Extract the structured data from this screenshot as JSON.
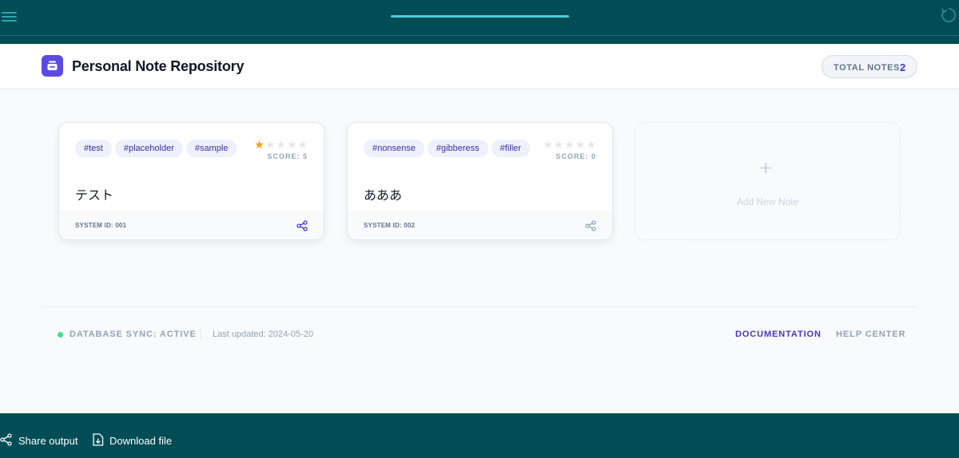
{
  "app": {
    "title": "Personal Note Repository",
    "total_label": "TOTAL NOTES",
    "total_count": "2"
  },
  "notes": [
    {
      "tags": [
        "#test",
        "#placeholder",
        "#sample"
      ],
      "rating": 1,
      "max_rating": 5,
      "score_label": "SCORE: 5",
      "content": "テスト",
      "system_id": "SYSTEM ID: 001"
    },
    {
      "tags": [
        "#nonsense",
        "#gibberess",
        "#filler"
      ],
      "rating": 0,
      "max_rating": 5,
      "score_label": "SCORE: 0",
      "content": "あああ",
      "system_id": "SYSTEM ID: 002"
    }
  ],
  "add_note": {
    "plus": "+",
    "label": "Add New Note"
  },
  "footer": {
    "sync_status": "DATABASE SYNC: ACTIVE",
    "last_updated": "Last updated: 2024-05-20",
    "documentation": "DOCUMENTATION",
    "help_center": "HELP CENTER"
  },
  "bottom_bar": {
    "share_output": "Share output",
    "download_file": "Download file"
  },
  "colors": {
    "dark_bar": "#004d55",
    "accent": "#5b4be0",
    "star_on": "#f59e0b",
    "sync_dot": "#4ade80"
  },
  "icons": {
    "menu": "menu-icon",
    "refresh": "refresh-icon",
    "logo": "inbox-tray-icon",
    "share": "share-icon",
    "download": "download-file-icon",
    "plus": "plus-icon"
  }
}
